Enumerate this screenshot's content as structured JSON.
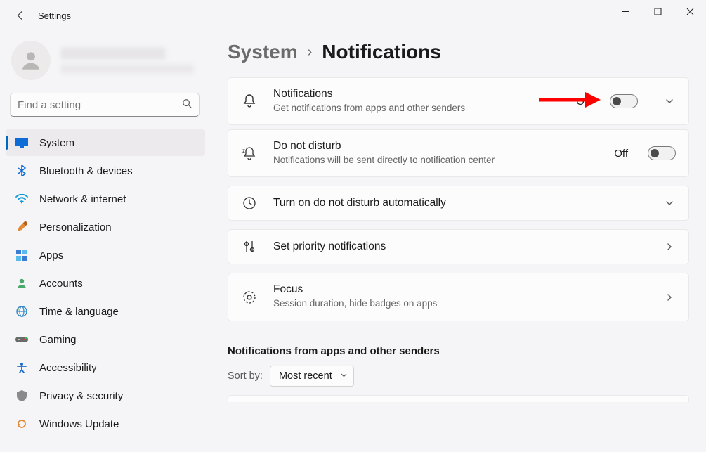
{
  "window": {
    "title": "Settings"
  },
  "search": {
    "placeholder": "Find a setting"
  },
  "sidebar": {
    "items": [
      {
        "label": "System",
        "icon": "monitor-icon",
        "active": true
      },
      {
        "label": "Bluetooth & devices",
        "icon": "bluetooth-icon"
      },
      {
        "label": "Network & internet",
        "icon": "wifi-icon"
      },
      {
        "label": "Personalization",
        "icon": "brush-icon"
      },
      {
        "label": "Apps",
        "icon": "apps-icon"
      },
      {
        "label": "Accounts",
        "icon": "person-icon"
      },
      {
        "label": "Time & language",
        "icon": "globe-icon"
      },
      {
        "label": "Gaming",
        "icon": "gamepad-icon"
      },
      {
        "label": "Accessibility",
        "icon": "accessibility-icon"
      },
      {
        "label": "Privacy & security",
        "icon": "shield-icon"
      },
      {
        "label": "Windows Update",
        "icon": "update-icon"
      }
    ]
  },
  "breadcrumb": {
    "parent": "System",
    "current": "Notifications"
  },
  "cards": {
    "notifications": {
      "title": "Notifications",
      "sub": "Get notifications from apps and other senders",
      "state": "Off"
    },
    "dnd": {
      "title": "Do not disturb",
      "sub": "Notifications will be sent directly to notification center",
      "state": "Off"
    },
    "auto_dnd": {
      "title": "Turn on do not disturb automatically"
    },
    "priority": {
      "title": "Set priority notifications"
    },
    "focus": {
      "title": "Focus",
      "sub": "Session duration, hide badges on apps"
    }
  },
  "section": {
    "apps_header": "Notifications from apps and other senders",
    "sort_label": "Sort by:",
    "sort_value": "Most recent"
  }
}
